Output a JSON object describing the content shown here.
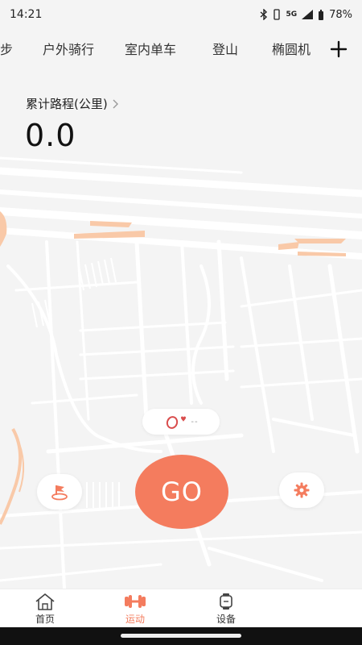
{
  "status_bar": {
    "time": "14:21",
    "network": "5G",
    "battery": "78%"
  },
  "tabs": {
    "items": [
      {
        "label": "跑步"
      },
      {
        "label": "户外骑行"
      },
      {
        "label": "室内单车"
      },
      {
        "label": "登山"
      },
      {
        "label": "椭圆机"
      }
    ],
    "add_icon": "plus-icon"
  },
  "summary": {
    "label": "累计路程(公里)",
    "value": "0.0"
  },
  "device": {
    "status": "--"
  },
  "actions": {
    "go_label": "GO",
    "left_icon": "route-flag-icon",
    "right_icon": "gear-icon"
  },
  "bottom_nav": {
    "items": [
      {
        "label": "首页",
        "icon": "home-icon"
      },
      {
        "label": "运动",
        "icon": "dumbbell-icon"
      },
      {
        "label": "设备",
        "icon": "watch-icon"
      }
    ]
  },
  "colors": {
    "accent": "#f47c5e",
    "map_background": "#f4f4f4",
    "map_roads": "#ffffff",
    "map_highlight": "#f9c9a8"
  }
}
